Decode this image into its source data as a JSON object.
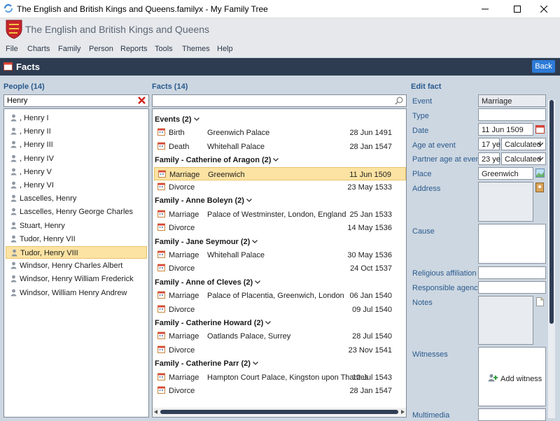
{
  "window": {
    "title": "The English and British Kings and Queens.familyx - My Family Tree"
  },
  "header": {
    "title": "The English and British Kings and Queens"
  },
  "menu": [
    "File",
    "Charts",
    "Family",
    "Person",
    "Reports",
    "Tools",
    "Themes",
    "Help"
  ],
  "page": {
    "title": "Facts",
    "back_label": "Back"
  },
  "people": {
    "heading": "People (14)",
    "search_value": "Henry",
    "items": [
      ", Henry I",
      ", Henry II",
      ", Henry III",
      ", Henry IV",
      ", Henry V",
      ", Henry VI",
      "Lascelles, Henry",
      "Lascelles, Henry George Charles",
      "Stuart, Henry",
      "Tudor, Henry VII",
      "Tudor, Henry VIII",
      "Windsor, Henry Charles Albert",
      "Windsor, Henry William Frederick",
      "Windsor, William Henry Andrew"
    ],
    "selected_index": 10
  },
  "facts": {
    "heading": "Facts (14)",
    "search_value": "",
    "groups": [
      {
        "title": "Events (2)",
        "rows": [
          {
            "event": "Birth",
            "place": "Greenwich Palace",
            "date": "28 Jun 1491"
          },
          {
            "event": "Death",
            "place": "Whitehall Palace",
            "date": "28 Jan 1547"
          }
        ]
      },
      {
        "title": "Family - Catherine of Aragon (2)",
        "rows": [
          {
            "event": "Marriage",
            "place": "Greenwich",
            "date": "11 Jun 1509",
            "selected": true
          },
          {
            "event": "Divorce",
            "place": "",
            "date": "23 May 1533"
          }
        ]
      },
      {
        "title": "Family - Anne Boleyn (2)",
        "rows": [
          {
            "event": "Marriage",
            "place": "Palace of Westminster, London, England",
            "date": "25 Jan 1533"
          },
          {
            "event": "Divorce",
            "place": "",
            "date": "14 May 1536"
          }
        ]
      },
      {
        "title": "Family - Jane Seymour (2)",
        "rows": [
          {
            "event": "Marriage",
            "place": "Whitehall Palace",
            "date": "30 May 1536"
          },
          {
            "event": "Divorce",
            "place": "",
            "date": "24 Oct 1537"
          }
        ]
      },
      {
        "title": "Family - Anne of Cleves (2)",
        "rows": [
          {
            "event": "Marriage",
            "place": "Palace of Placentia, Greenwich, London",
            "date": "06 Jan 1540"
          },
          {
            "event": "Divorce",
            "place": "",
            "date": "09 Jul 1540"
          }
        ]
      },
      {
        "title": "Family - Catherine Howard (2)",
        "rows": [
          {
            "event": "Marriage",
            "place": "Oatlands Palace, Surrey",
            "date": "28 Jul 1540"
          },
          {
            "event": "Divorce",
            "place": "",
            "date": "23 Nov 1541"
          }
        ]
      },
      {
        "title": "Family - Catherine Parr (2)",
        "rows": [
          {
            "event": "Marriage",
            "place": "Hampton Court Palace, Kingston upon Thames",
            "date": "12 Jul 1543"
          },
          {
            "event": "Divorce",
            "place": "",
            "date": "28 Jan 1547"
          }
        ]
      }
    ]
  },
  "edit": {
    "heading": "Edit fact",
    "labels": {
      "event": "Event",
      "type": "Type",
      "date": "Date",
      "age": "Age at event",
      "partner_age": "Partner age at event",
      "place": "Place",
      "address": "Address",
      "cause": "Cause",
      "religion": "Religious affiliation",
      "agency": "Responsible agency",
      "notes": "Notes",
      "witnesses": "Witnesses",
      "multimedia": "Multimedia"
    },
    "event": "Marriage",
    "type": "",
    "date": "11 Jun 1509",
    "age": "17 ye",
    "age_mode": "Calculated",
    "partner_age": "23 ye",
    "partner_age_mode": "Calculated",
    "place": "Greenwich",
    "add_witness_label": "Add witness"
  }
}
